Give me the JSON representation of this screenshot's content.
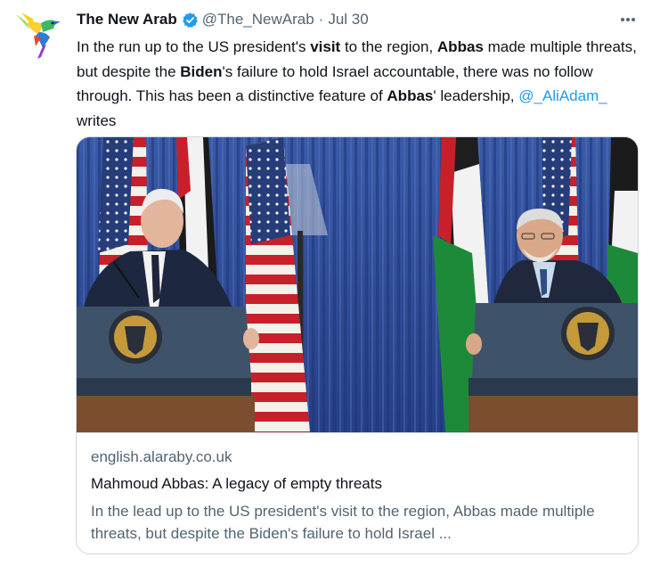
{
  "tweet": {
    "display_name": "The New Arab",
    "handle": "@The_NewArab",
    "separator": "·",
    "date": "Jul 30",
    "more_icon": "more-horizontal-icon",
    "verified_icon": "verified-badge-icon",
    "avatar_icon": "hummingbird-logo",
    "colors": {
      "text": "#0f1419",
      "secondary": "#536471",
      "link": "#1d9bf0",
      "verified": "#1d9bf0",
      "border": "#cfd9de"
    },
    "body": {
      "t1": "In the run up to the US president's ",
      "b1": "visit",
      "t2": " to the region, ",
      "b2": "Abbas",
      "t3": " made multiple threats, but despite the ",
      "b3": "Biden",
      "t4": "'s failure to hold Israel accountable, there was no follow through. This has been a distinctive feature of ",
      "b4": "Abbas",
      "t5": "' leadership, ",
      "mention": "@_AliAdam_",
      "t6": " writes"
    },
    "card": {
      "domain": "english.alaraby.co.uk",
      "title": "Mahmoud Abbas: A legacy of empty threats",
      "description": "In the lead up to the US president's visit to the region, Abbas made multiple threats, but despite the Biden's failure to hold Israel ..."
    }
  }
}
